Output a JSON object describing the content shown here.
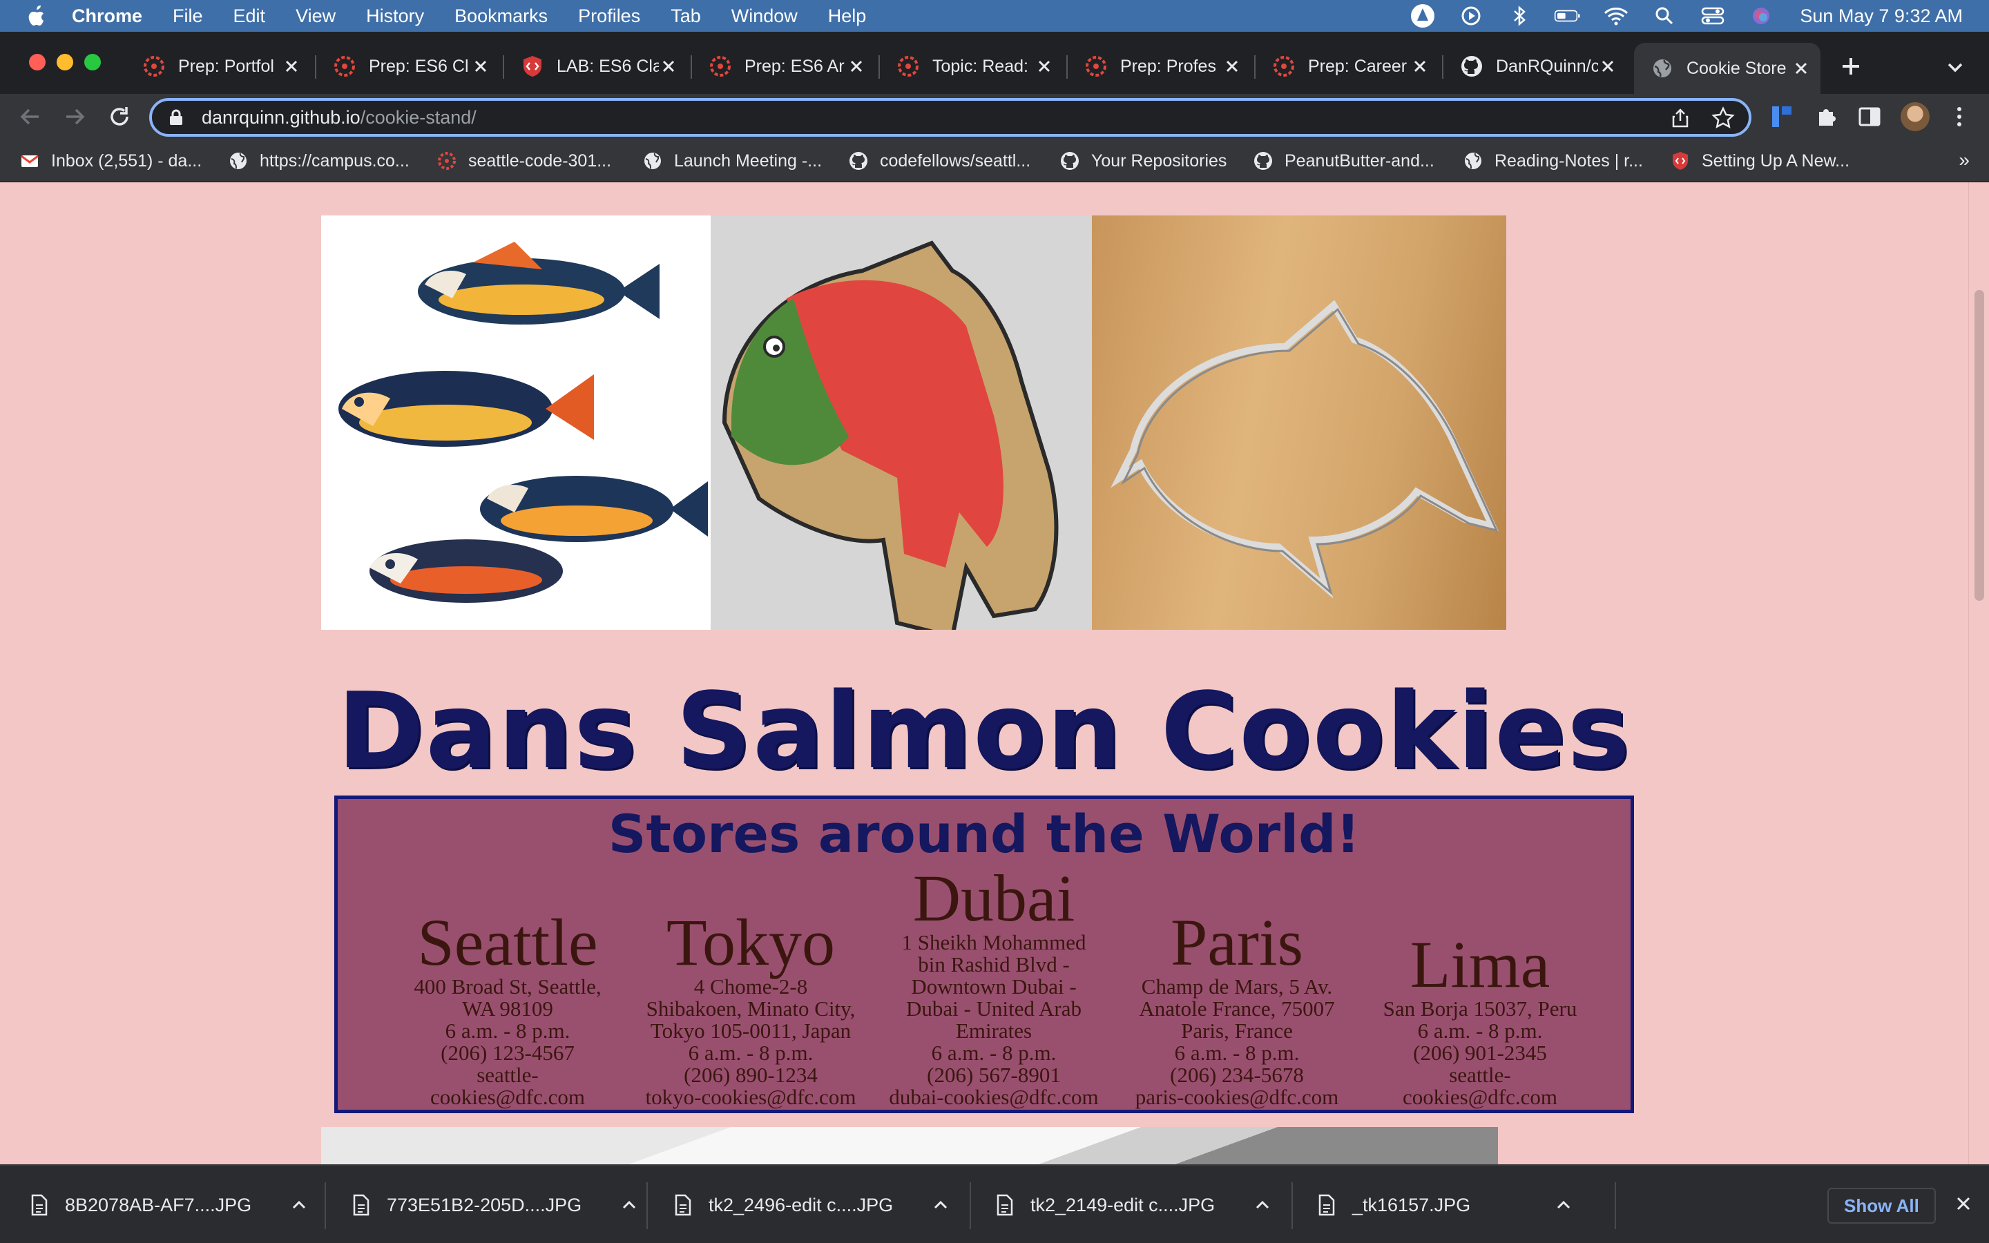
{
  "menubar": {
    "app": "Chrome",
    "items": [
      "File",
      "Edit",
      "View",
      "History",
      "Bookmarks",
      "Profiles",
      "Tab",
      "Window",
      "Help"
    ],
    "clock": "Sun May 7  9:32 AM"
  },
  "tabs": [
    {
      "title": "Prep: Portfol",
      "icon": "canvas-icon"
    },
    {
      "title": "Prep: ES6 Cl",
      "icon": "canvas-icon"
    },
    {
      "title": "LAB: ES6 Cla",
      "icon": "code-shield-icon"
    },
    {
      "title": "Prep: ES6 Ar",
      "icon": "canvas-icon"
    },
    {
      "title": "Topic: Read:",
      "icon": "canvas-icon"
    },
    {
      "title": "Prep: Profes",
      "icon": "canvas-icon"
    },
    {
      "title": "Prep: Career",
      "icon": "canvas-icon"
    },
    {
      "title": "DanRQuinn/c",
      "icon": "github-icon"
    },
    {
      "title": "Cookie Store",
      "icon": "globe-icon",
      "active": true
    }
  ],
  "address": {
    "host": "danrquinn.github.io",
    "path": "/cookie-stand/"
  },
  "bookmarks": [
    {
      "label": "Inbox (2,551) - da...",
      "icon": "gmail-icon"
    },
    {
      "label": "https://campus.co...",
      "icon": "globe-icon"
    },
    {
      "label": "seattle-code-301...",
      "icon": "canvas-icon"
    },
    {
      "label": "Launch Meeting -...",
      "icon": "globe-icon"
    },
    {
      "label": "codefellows/seattl...",
      "icon": "github-icon"
    },
    {
      "label": "Your Repositories",
      "icon": "github-icon"
    },
    {
      "label": "PeanutButter-and...",
      "icon": "github-icon"
    },
    {
      "label": "Reading-Notes | r...",
      "icon": "globe-icon"
    },
    {
      "label": "Setting Up A New...",
      "icon": "code-shield-icon"
    }
  ],
  "page": {
    "title": "Dans Salmon Cookies",
    "stores_heading": "Stores around the World!",
    "stores": [
      {
        "city": "Seattle",
        "lines": [
          "400 Broad St, Seattle,",
          "WA 98109",
          "6 a.m. - 8 p.m.",
          "(206) 123-4567",
          "seattle-",
          "cookies@dfc.com"
        ]
      },
      {
        "city": "Tokyo",
        "lines": [
          "4 Chome-2-8",
          "Shibakoen, Minato City,",
          "Tokyo 105-0011, Japan",
          "6 a.m. - 8 p.m.",
          "(206) 890-1234",
          "tokyo-cookies@dfc.com"
        ]
      },
      {
        "city": "Dubai",
        "lines": [
          "1 Sheikh Mohammed",
          "bin Rashid Blvd -",
          "Downtown Dubai -",
          "Dubai - United Arab",
          "Emirates",
          "6 a.m. - 8 p.m.",
          "(206) 567-8901",
          "dubai-cookies@dfc.com"
        ]
      },
      {
        "city": "Paris",
        "lines": [
          "Champ de Mars, 5 Av.",
          "Anatole France, 75007",
          "Paris, France",
          "6 a.m. - 8 p.m.",
          "(206) 234-5678",
          "paris-cookies@dfc.com"
        ]
      },
      {
        "city": "Lima",
        "lines": [
          "San Borja 15037, Peru",
          "6 a.m. - 8 p.m.",
          "(206) 901-2345",
          "seattle-",
          "cookies@dfc.com"
        ]
      }
    ]
  },
  "downloads": {
    "files": [
      "8B2078AB-AF7....JPG",
      "773E51B2-205D....JPG",
      "tk2_2496-edit c....JPG",
      "tk2_2149-edit c....JPG",
      "_tk16157.JPG"
    ],
    "show_all": "Show All"
  },
  "colors": {
    "page_bg": "#f2c7c5",
    "title": "#15175f",
    "stores_bg": "#99506f",
    "stores_border": "#141878",
    "store_text": "#3b160f"
  }
}
